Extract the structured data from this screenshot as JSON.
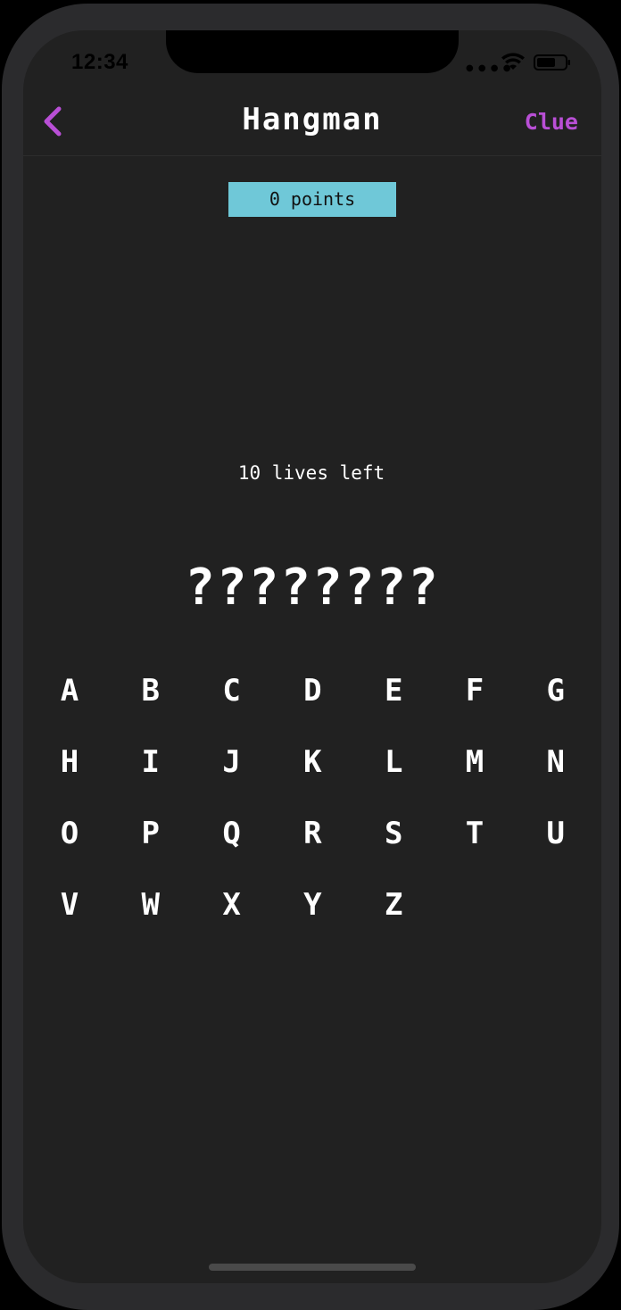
{
  "status_bar": {
    "time": "12:34",
    "signal_icon": "signal-dots-icon",
    "wifi_icon": "wifi-icon",
    "battery_icon": "battery-icon"
  },
  "nav": {
    "back_icon": "chevron-left-icon",
    "title": "Hangman",
    "clue_label": "Clue"
  },
  "game": {
    "points": "0 points",
    "lives": "10 lives left",
    "word": "????????"
  },
  "keyboard": {
    "letters": [
      "A",
      "B",
      "C",
      "D",
      "E",
      "F",
      "G",
      "H",
      "I",
      "J",
      "K",
      "L",
      "M",
      "N",
      "O",
      "P",
      "Q",
      "R",
      "S",
      "T",
      "U",
      "V",
      "W",
      "X",
      "Y",
      "Z"
    ]
  },
  "colors": {
    "background": "#212121",
    "accent": "#b94fd6",
    "points_badge": "#6fc8d8",
    "text": "#ffffff"
  }
}
